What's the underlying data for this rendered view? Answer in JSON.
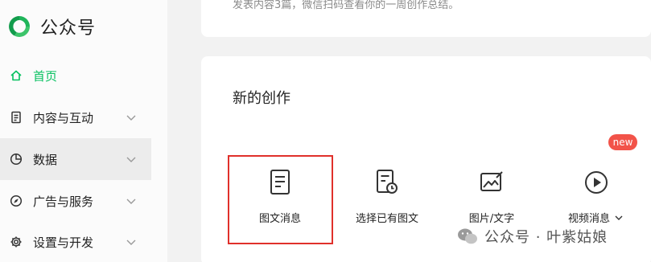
{
  "app": {
    "name": "公众号"
  },
  "sidebar": {
    "items": [
      {
        "label": "首页",
        "icon": "home-icon"
      },
      {
        "label": "内容与互动",
        "icon": "document-icon"
      },
      {
        "label": "数据",
        "icon": "pie-chart-icon"
      },
      {
        "label": "广告与服务",
        "icon": "compass-icon"
      },
      {
        "label": "设置与开发",
        "icon": "gear-icon"
      }
    ]
  },
  "summary": {
    "text": "发表内容3篇，微信扫码查看你的一周创作总结。"
  },
  "create": {
    "title": "新的创作",
    "badge": "new",
    "tiles": [
      {
        "label": "图文消息",
        "icon": "article-icon"
      },
      {
        "label": "选择已有图文",
        "icon": "existing-article-icon"
      },
      {
        "label": "图片/文字",
        "icon": "image-text-icon"
      },
      {
        "label": "视频消息",
        "icon": "video-play-icon"
      }
    ]
  },
  "watermark": {
    "text": "公众号 · 叶紫姑娘"
  },
  "colors": {
    "accent": "#07c160",
    "highlight": "#e0302b",
    "badge": "#f25349"
  }
}
